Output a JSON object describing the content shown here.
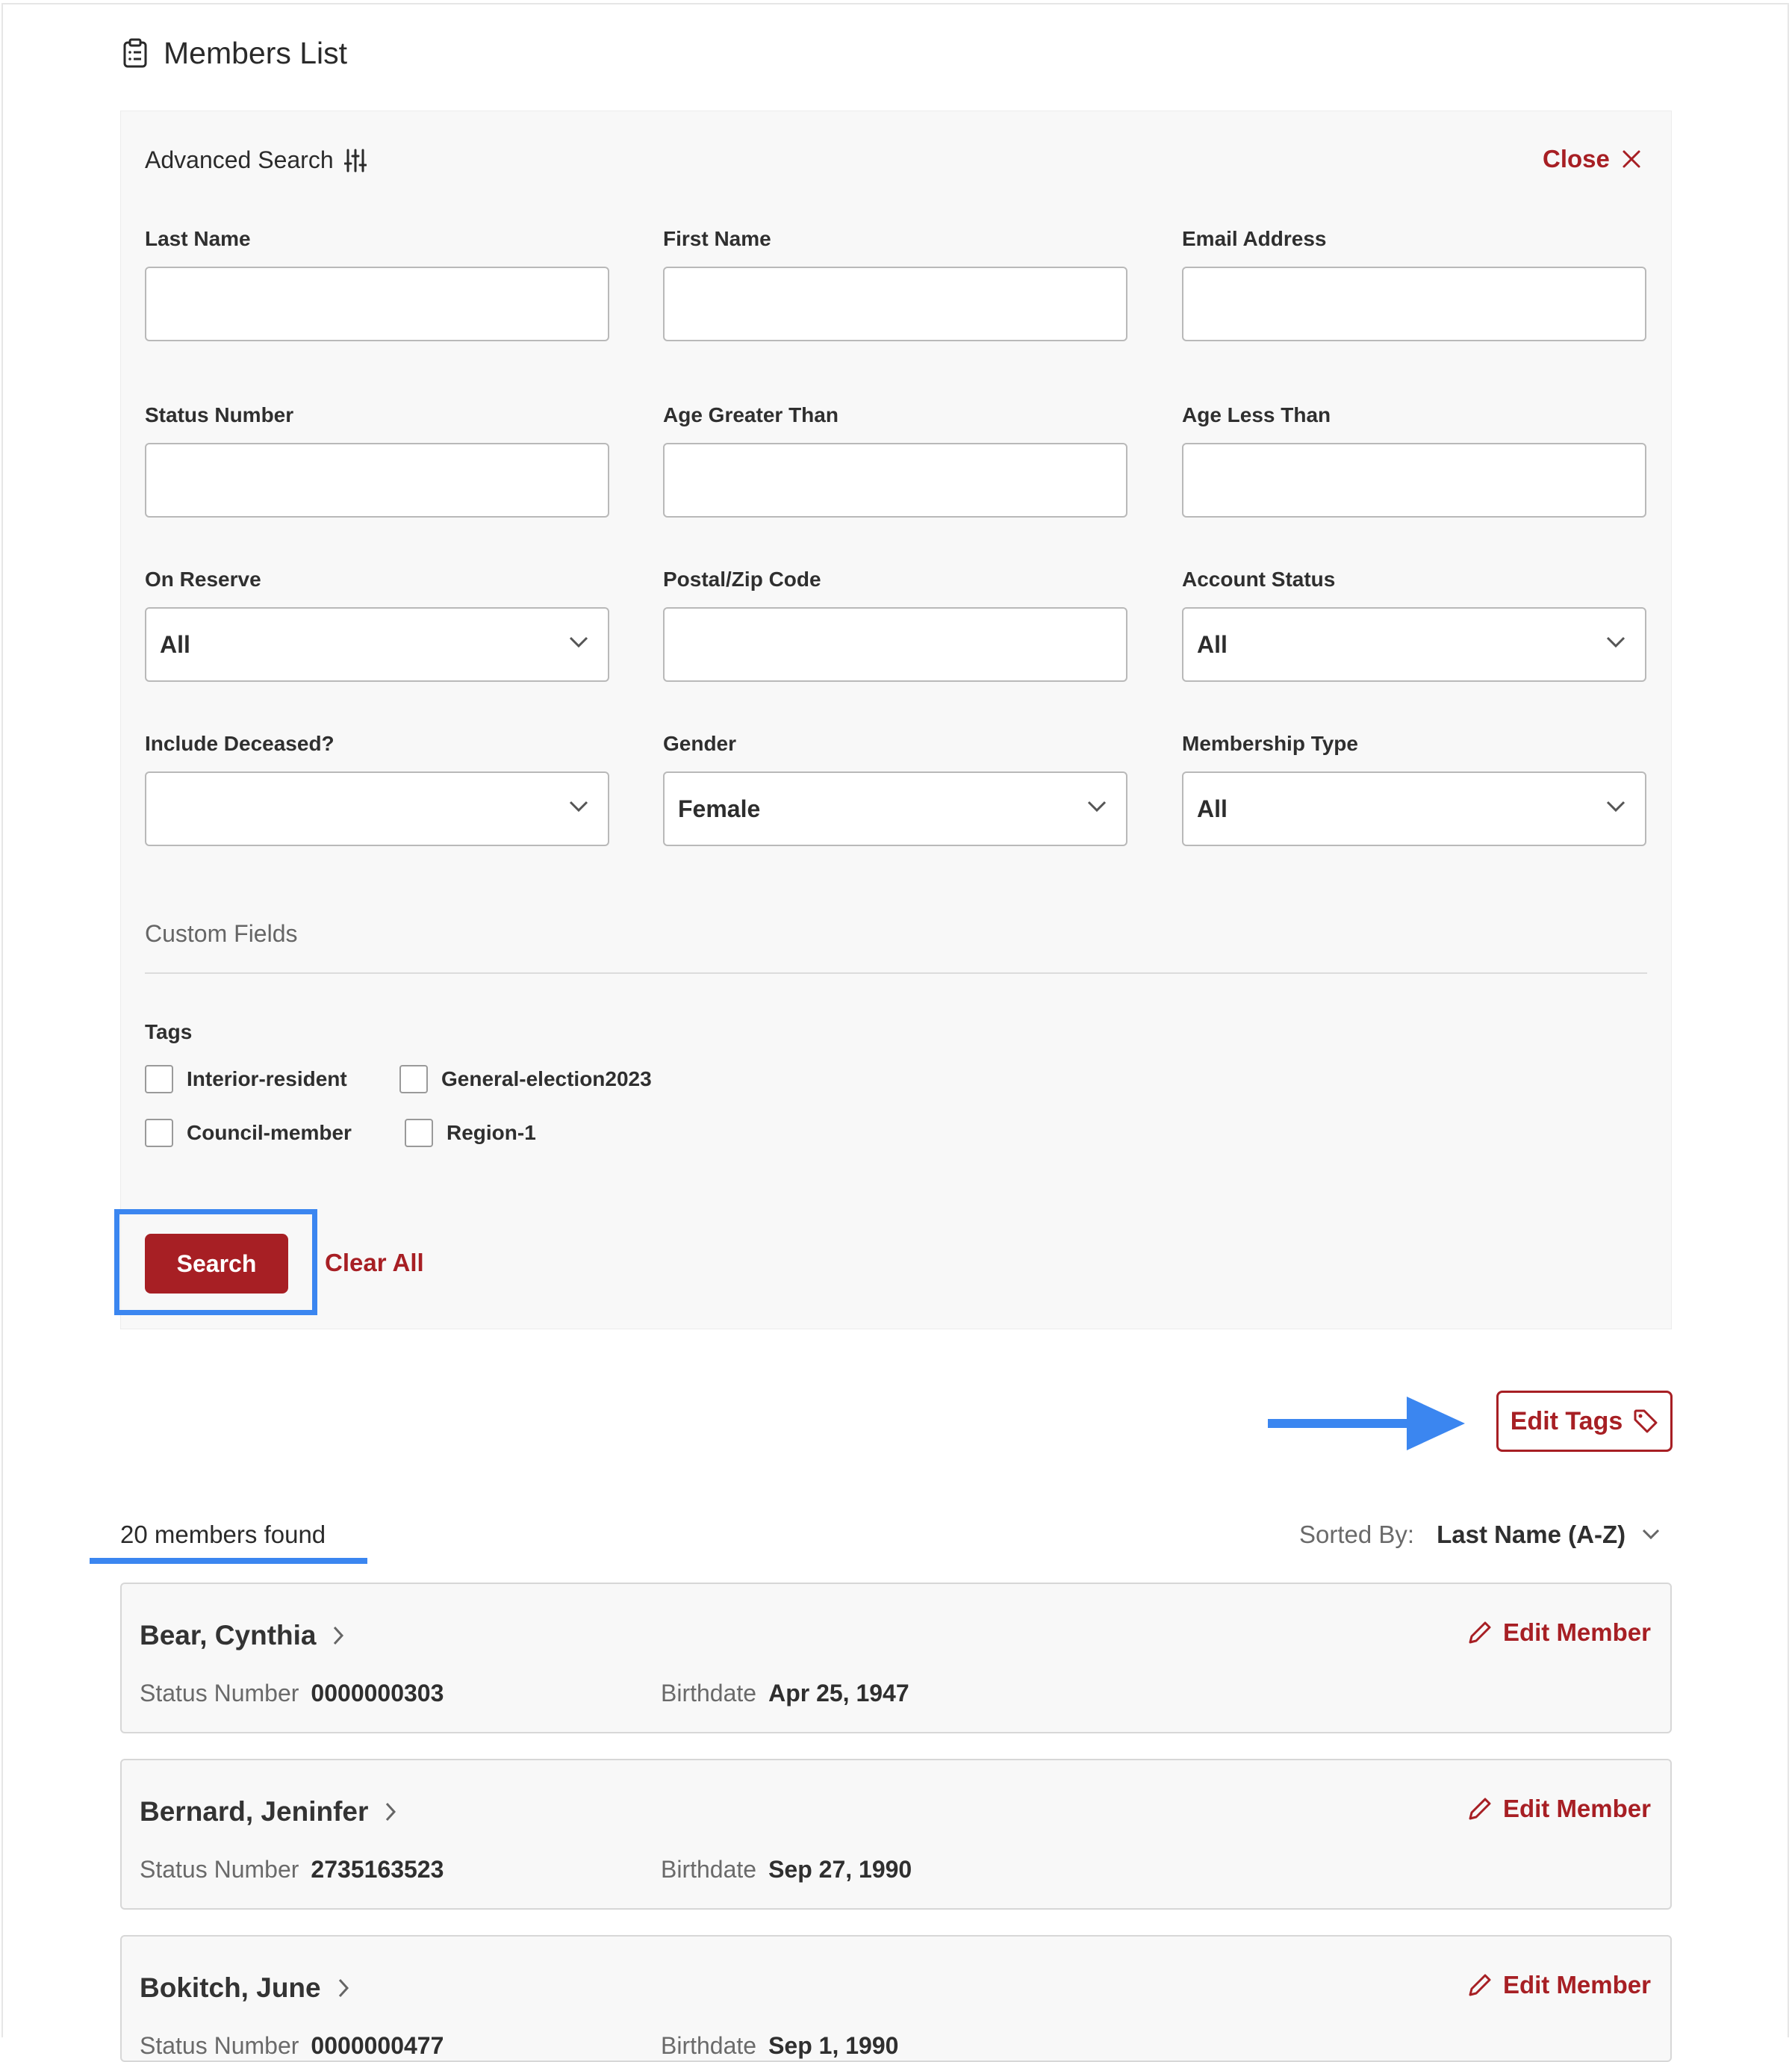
{
  "header": {
    "title": "Members List",
    "icon": "clipboard-icon"
  },
  "advanced_search": {
    "title": "Advanced Search",
    "close_label": "Close",
    "fields": [
      {
        "label": "Last Name",
        "type": "text",
        "value": ""
      },
      {
        "label": "First Name",
        "type": "text",
        "value": ""
      },
      {
        "label": "Email Address",
        "type": "text",
        "value": ""
      },
      {
        "label": "Status Number",
        "type": "text",
        "value": ""
      },
      {
        "label": "Age Greater Than",
        "type": "text",
        "value": ""
      },
      {
        "label": "Age Less Than",
        "type": "text",
        "value": ""
      },
      {
        "label": "On Reserve",
        "type": "select",
        "value": "All"
      },
      {
        "label": "Postal/Zip Code",
        "type": "text",
        "value": ""
      },
      {
        "label": "Account Status",
        "type": "select",
        "value": "All"
      },
      {
        "label": "Include Deceased?",
        "type": "select",
        "value": ""
      },
      {
        "label": "Gender",
        "type": "select",
        "value": "Female"
      },
      {
        "label": "Membership Type",
        "type": "select",
        "value": "All"
      }
    ],
    "custom_fields_label": "Custom Fields",
    "tags_label": "Tags",
    "tags": [
      {
        "label": "Interior-resident",
        "checked": false
      },
      {
        "label": "General-election2023",
        "checked": false
      },
      {
        "label": "Council-member",
        "checked": false
      },
      {
        "label": "Region-1",
        "checked": false
      }
    ],
    "search_label": "Search",
    "clear_label": "Clear All"
  },
  "edit_tags_label": "Edit Tags",
  "results": {
    "count_text": "20 members found",
    "sort_label": "Sorted By:",
    "sort_value": "Last Name (A-Z)",
    "members": [
      {
        "name": "Bear, Cynthia",
        "status_label": "Status Number",
        "status_number": "0000000303",
        "birth_label": "Birthdate",
        "birthdate": "Apr 25, 1947",
        "edit_label": "Edit Member"
      },
      {
        "name": "Bernard, Jeninfer",
        "status_label": "Status Number",
        "status_number": "2735163523",
        "birth_label": "Birthdate",
        "birthdate": "Sep 27, 1990",
        "edit_label": "Edit Member"
      },
      {
        "name": "Bokitch, June",
        "status_label": "Status Number",
        "status_number": "0000000477",
        "birth_label": "Birthdate",
        "birthdate": "Sep 1, 1990",
        "edit_label": "Edit Member"
      }
    ]
  },
  "colors": {
    "accent": "#a71f24",
    "annotation": "#3b86f0"
  }
}
